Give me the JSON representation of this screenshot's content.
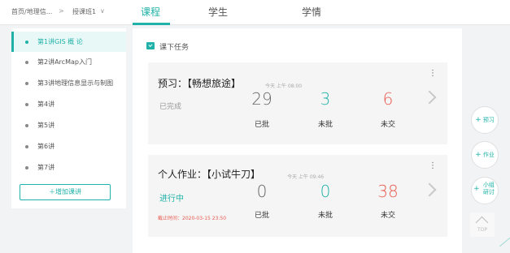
{
  "header": {
    "breadcrumb_home": "首页/地理信...",
    "breadcrumb_sep": ">",
    "breadcrumb_class": "授课班1",
    "breadcrumb_chevron": "∨",
    "tabs": [
      {
        "label": "课程",
        "active": true
      },
      {
        "label": "学生",
        "active": false
      },
      {
        "label": "学情",
        "active": false
      }
    ]
  },
  "sidebar": {
    "items": [
      {
        "label": "第1讲GIS 概 论",
        "active": true
      },
      {
        "label": "第2讲ArcMap入门",
        "active": false
      },
      {
        "label": "第3讲地理信息显示与制图",
        "active": false
      },
      {
        "label": "第4讲",
        "active": false
      },
      {
        "label": "第5讲",
        "active": false
      },
      {
        "label": "第6讲",
        "active": false
      },
      {
        "label": "第7讲",
        "active": false
      }
    ],
    "add_button": "＋增加课讲"
  },
  "main": {
    "section_title": "课下任务",
    "cards": [
      {
        "title": "预习：【畅想旅途】",
        "time": "今天 上午 08:00",
        "menu": "⋮",
        "status": "已完成",
        "deadline": "",
        "stats": [
          {
            "value": "29",
            "label": "已批"
          },
          {
            "value": "3",
            "label": "未批"
          },
          {
            "value": "6",
            "label": "未交"
          }
        ]
      },
      {
        "title": "个人作业：【小试牛刀】",
        "time": "今天 上午 09:46",
        "menu": "⋮",
        "status": "进行中",
        "deadline": "截止时间：2020-03-15 23:50",
        "stats": [
          {
            "value": "0",
            "label": "已批"
          },
          {
            "value": "0",
            "label": "未批"
          },
          {
            "value": "38",
            "label": "未交"
          }
        ]
      }
    ]
  },
  "float_buttons": {
    "preview": "预习",
    "homework": "作业",
    "group": "小组研讨",
    "plus": "+",
    "top": "TOP"
  },
  "colors": {
    "accent": "#20b2a8",
    "danger": "#e85a4f"
  }
}
